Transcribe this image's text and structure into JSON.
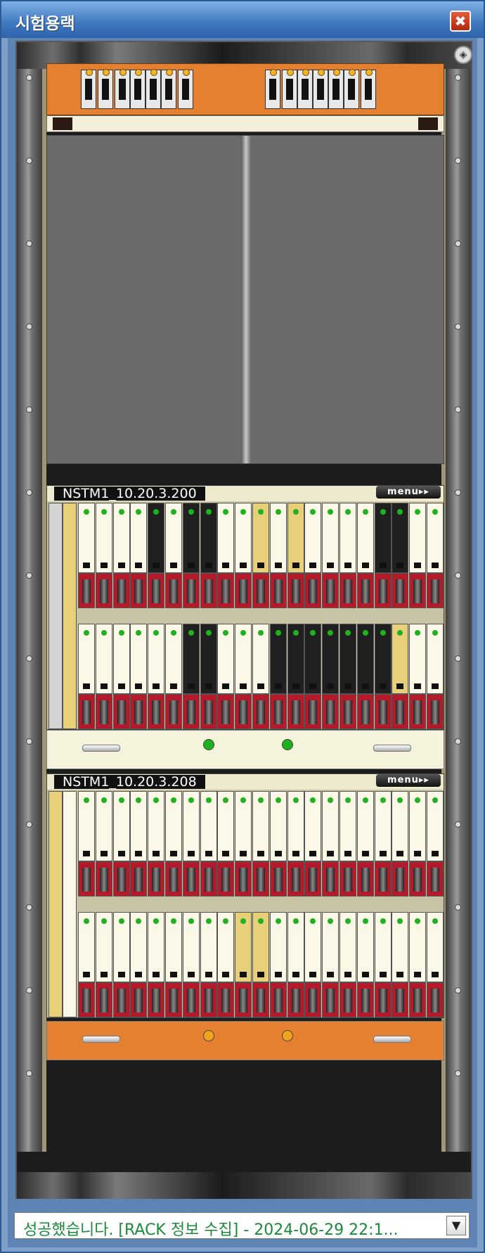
{
  "window": {
    "title": "시험용랙",
    "close_glyph": "✖"
  },
  "rack": {
    "top_icon": "◈",
    "shelves": [
      {
        "name": "NSTM1_10.20.3.200",
        "menu_label": "menu▸▸",
        "fan_led_color": "#1fb21f"
      },
      {
        "name": "NSTM1_10.20.3.208",
        "menu_label": "menu▸▸",
        "fan_led_color": "#f2a31c"
      }
    ],
    "colors": {
      "orange": "#e4802f",
      "red": "#b31b2a",
      "cream": "#fbf8e8",
      "tan": "#e8cf7a",
      "black": "#202020",
      "olive": "#b9b28a",
      "blue": "#3a5da8",
      "green_led": "#1fb21f"
    }
  },
  "status_bar": {
    "message": "성공했습니다. [RACK 정보 수집] - 2024-06-29 22:1...",
    "dropdown_icon": "chevron-down-icon",
    "dropdown_glyph": "▼"
  }
}
